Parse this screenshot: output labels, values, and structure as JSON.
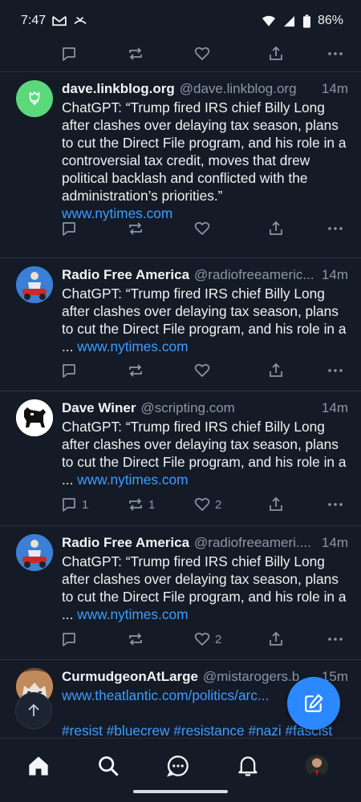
{
  "status_bar": {
    "time": "7:47",
    "battery": "86%",
    "icons": [
      "gmail-icon",
      "missed-call-icon",
      "wifi-icon",
      "signal-icon",
      "battery-icon"
    ]
  },
  "posts": [
    {
      "display_name": "dave.linkblog.org",
      "handle": "@dave.linkblog.org",
      "time": "14m",
      "text": "ChatGPT: “Trump fired IRS chief Billy Long after clashes over delaying tax season, plans to cut the Direct File program, and his role in a controversial tax credit, moves that drew political backlash and conflicted with the administration’s priorities.”",
      "link": "www.nytimes.com",
      "replies": "",
      "reposts": "",
      "likes": ""
    },
    {
      "display_name": "Radio Free America",
      "handle": "@radiofreeameric...",
      "time": "14m",
      "text": "ChatGPT: “Trump fired IRS chief Billy Long after clashes over delaying tax season, plans to cut the Direct File program, and his role in a ... ",
      "link": "www.nytimes.com",
      "replies": "",
      "reposts": "",
      "likes": ""
    },
    {
      "display_name": "Dave Winer",
      "handle": "@scripting.com",
      "time": "14m",
      "text": "ChatGPT: “Trump fired IRS chief Billy Long after clashes over delaying tax season, plans to cut the Direct File program, and his role in a ... ",
      "link": "www.nytimes.com",
      "replies": "1",
      "reposts": "1",
      "likes": "2"
    },
    {
      "display_name": "Radio Free America",
      "handle": "@radiofreeameri....",
      "time": "14m",
      "text": "ChatGPT: “Trump fired IRS chief Billy Long after clashes over delaying tax season, plans to cut the Direct File program, and his role in a ... ",
      "link": "www.nytimes.com",
      "replies": "",
      "reposts": "",
      "likes": "2"
    },
    {
      "display_name": "CurmudgeonAtLarge",
      "handle": "@mistarogers.b",
      "time": "15m",
      "link": "www.theatlantic.com/politics/arc...",
      "hashtags": "#resist #bluecrew #resistance #nazi #fascist"
    }
  ],
  "nav": {
    "items": [
      "home-icon",
      "search-icon",
      "chat-icon",
      "bell-icon",
      "profile-avatar"
    ]
  },
  "colors": {
    "background": "#141b26",
    "link": "#3f9bff",
    "fab": "#2c88ff",
    "muted": "#8b96a8"
  }
}
